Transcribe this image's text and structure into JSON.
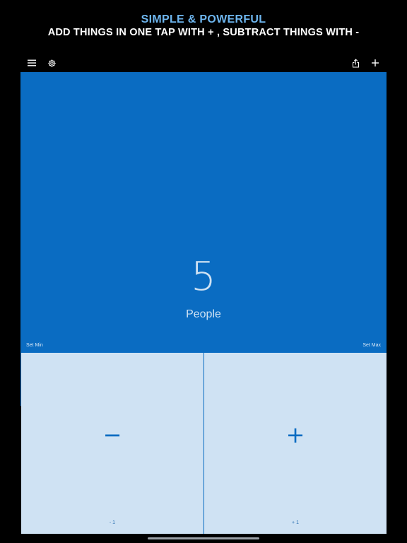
{
  "promo": {
    "headline": "SIMPLE & POWERFUL",
    "subheadline": "ADD THINGS IN ONE TAP WITH + ,  SUBTRACT THINGS WITH -"
  },
  "toolbar": {
    "left_icons": [
      "hamburger-menu-icon",
      "gear-icon"
    ],
    "right_icons": [
      "share-icon",
      "plus-icon"
    ]
  },
  "counter": {
    "value": "5",
    "label": "People",
    "set_min_label": "Set Min",
    "set_max_label": "Set Max"
  },
  "pads": {
    "decrement": {
      "symbol": "−",
      "step_label": "- 1"
    },
    "increment": {
      "symbol": "+",
      "step_label": "+ 1"
    }
  },
  "colors": {
    "accent": "#0a6cc2",
    "pad_background": "#cfe2f3",
    "headline": "#6eb6ef",
    "background": "#000000"
  }
}
